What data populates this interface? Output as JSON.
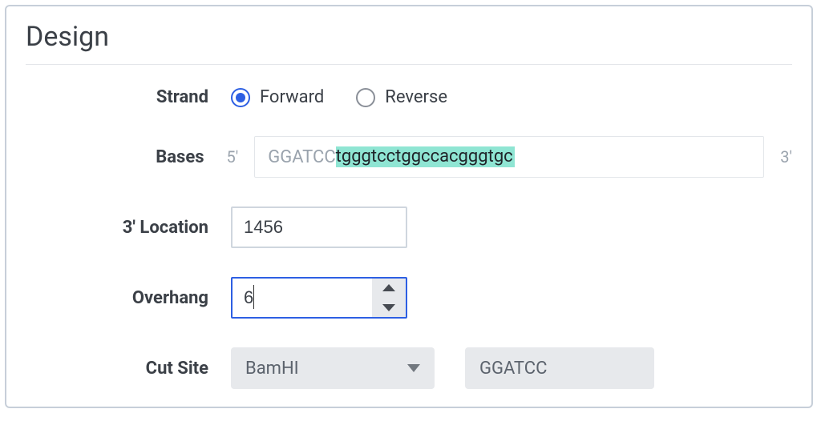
{
  "panel": {
    "title": "Design"
  },
  "labels": {
    "strand": "Strand",
    "bases": "Bases",
    "location3": "3' Location",
    "overhang": "Overhang",
    "cutsite": "Cut Site"
  },
  "strand": {
    "forward_label": "Forward",
    "reverse_label": "Reverse",
    "selected": "forward"
  },
  "bases": {
    "five_prime": "5'",
    "three_prime": "3'",
    "prefix_gray": "GGATCC",
    "highlighted": "tgggtcctggccacgggtgc"
  },
  "location3": {
    "value": "1456"
  },
  "overhang": {
    "value": "6"
  },
  "cutsite": {
    "enzyme": "BamHI",
    "sequence": "GGATCC"
  }
}
